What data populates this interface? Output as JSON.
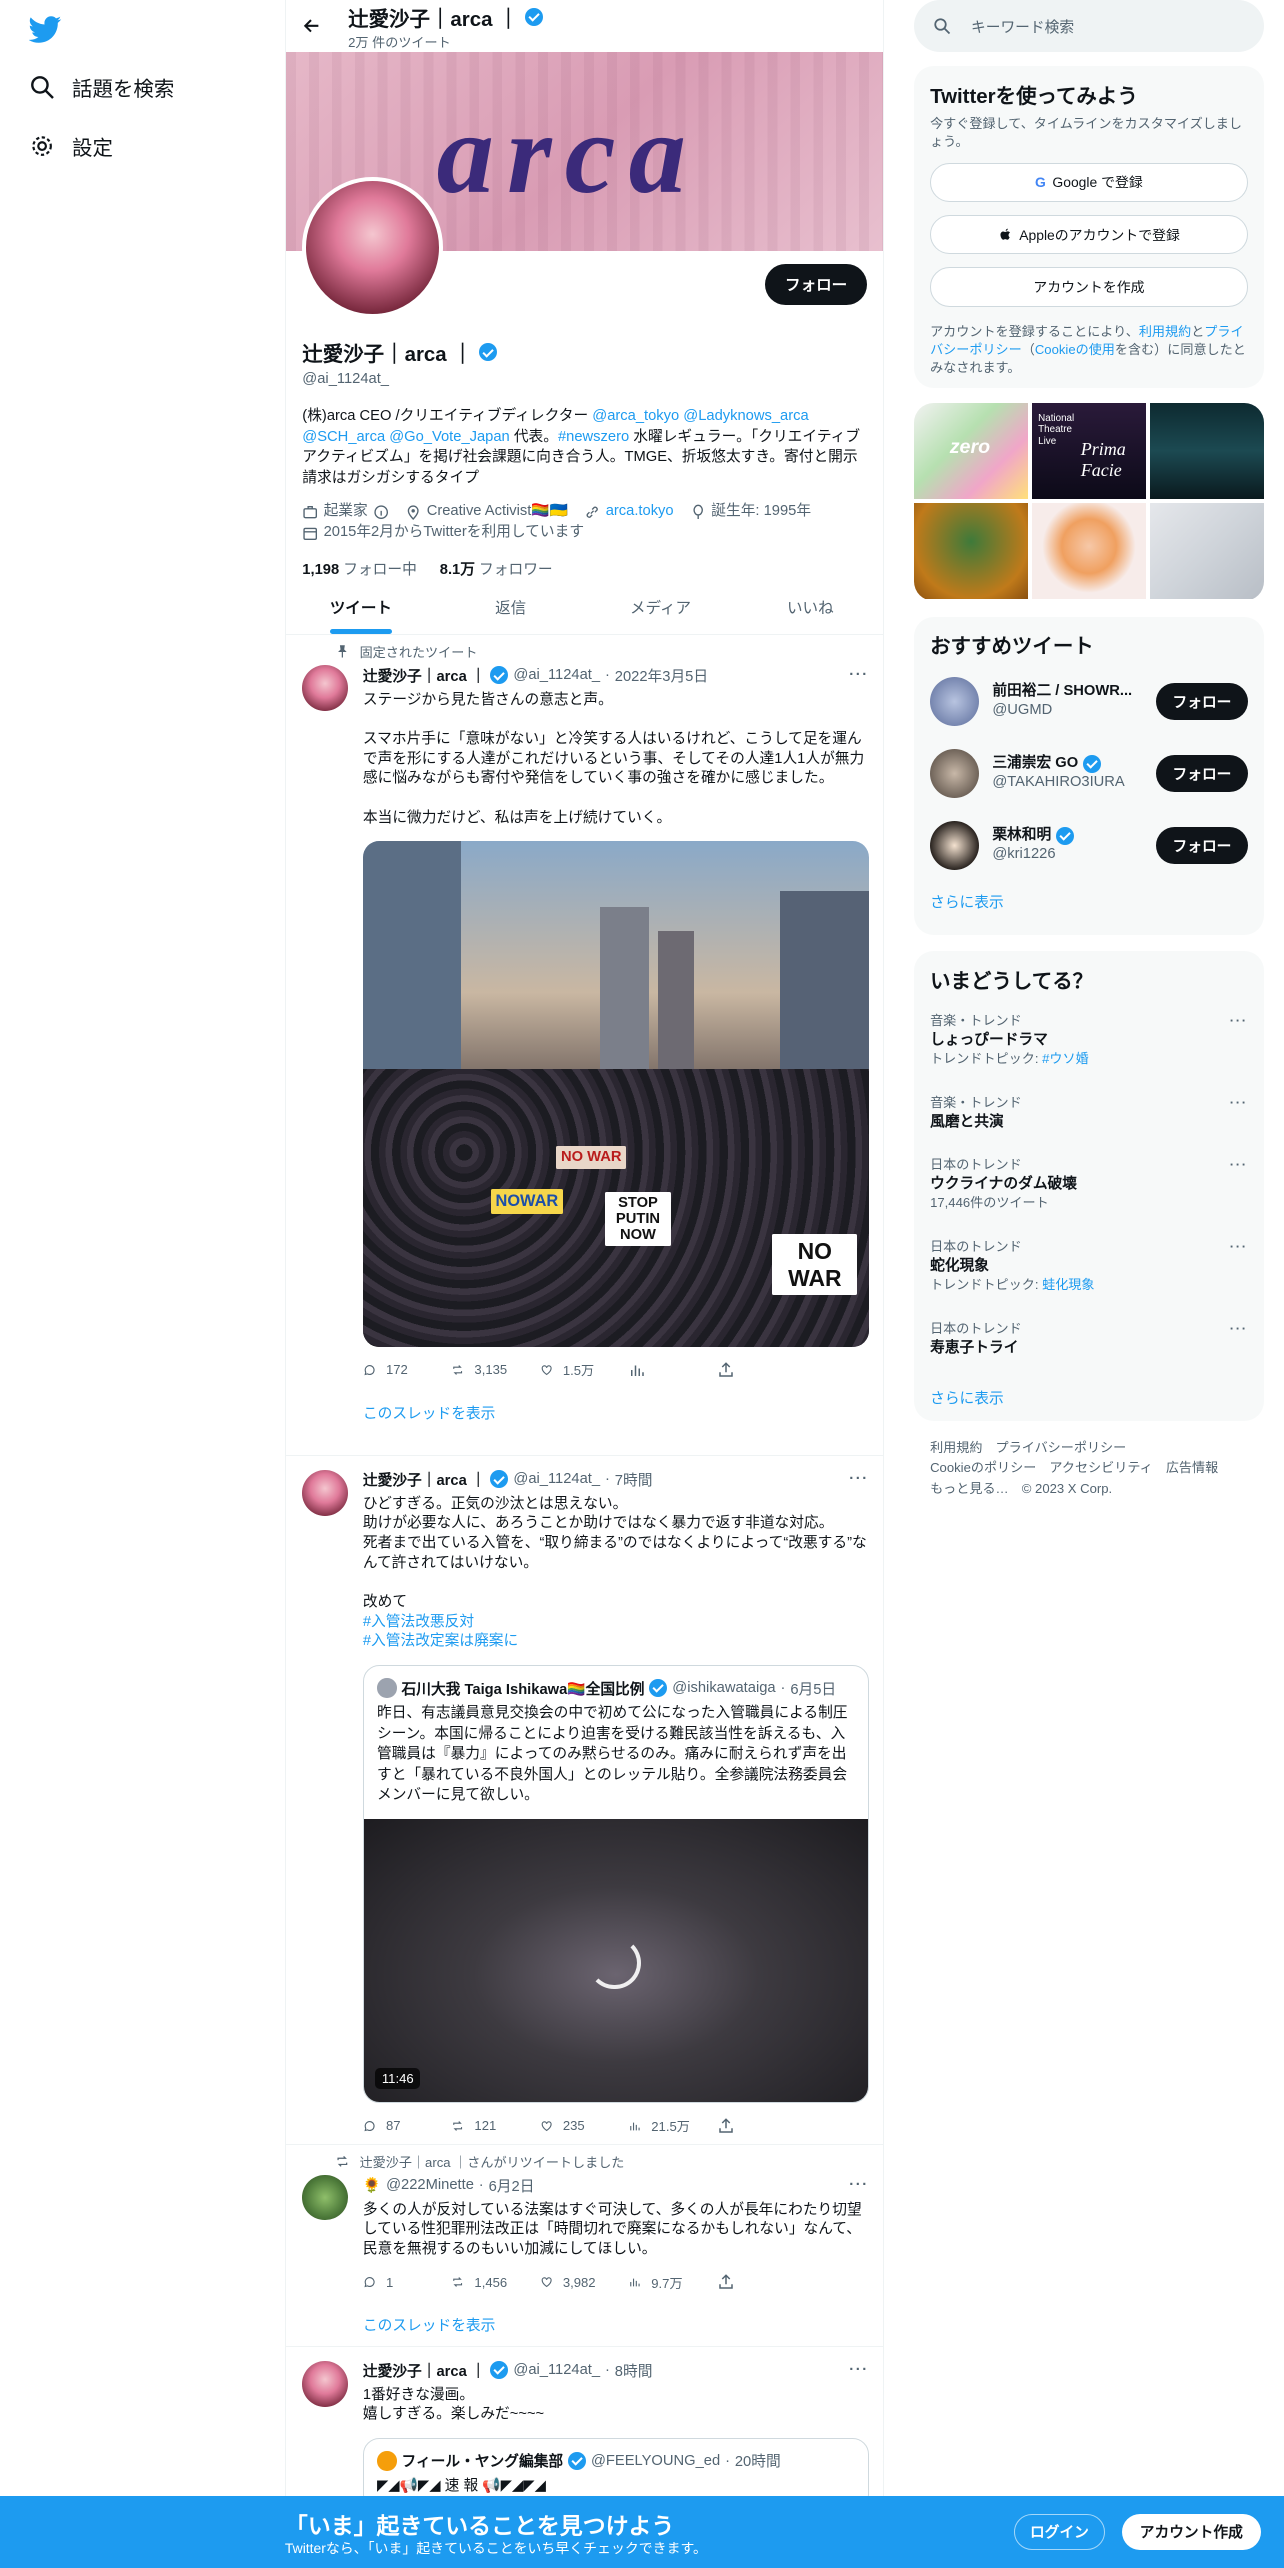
{
  "nav": {
    "logo_icon": "twitter-bird-icon",
    "explore_label": "話題を検索",
    "settings_label": "設定"
  },
  "header": {
    "back_icon": "arrow-left-icon",
    "name": "辻愛沙子｜arca ｜",
    "tweet_count": "2万 件のツイート"
  },
  "banner": {
    "word": "arca"
  },
  "profile": {
    "follow_label": "フォロー",
    "name": "辻愛沙子｜arca ｜",
    "handle": "@ai_1124at_",
    "bio_1": "(株)arca CEO /クリエイティブディレクター ",
    "bio_link_1": "@arca_tokyo @Ladyknows_arca @SCH_arca @Go_Vote_Japan",
    "bio_2": " 代表。",
    "bio_link_2": "#newszero",
    "bio_3": " 水曜レギュラー。「クリエイティブアクティビズム」を掲げ社会課題に向き合う人。TMGE、折坂悠太すき。寄付と開示請求はガシガシするタイプ",
    "category": "起業家",
    "location": "Creative Activist🏳️‍🌈🇺🇦",
    "website": "arca.tokyo",
    "birthday": "誕生年: 1995年",
    "joined": "2015年2月からTwitterを利用しています",
    "following_count": "1,198",
    "following_label": "フォロー中",
    "followers_count": "8.1万",
    "followers_label": "フォロワー"
  },
  "tabs": [
    "ツイート",
    "返信",
    "メディア",
    "いいね"
  ],
  "tweets": [
    {
      "pinned_label": "固定されたツイート",
      "name": "辻愛沙子｜arca ｜",
      "handle": "@ai_1124at_",
      "time": "2022年3月5日",
      "text": "ステージから見た皆さんの意志と声。\n\nスマホ片手に「意味がない」と冷笑する人はいるけれど、こうして足を運んで声を形にする人達がこれだけいるという事、そしてその人達1人1人が無力感に悩みながらも寄付や発信をしていく事の強さを確かに感じました。\n\n本当に微力だけど、私は声を上げ続けていく。",
      "signs": [
        "NOWAR",
        "STOP PUTIN NOW",
        "NO WAR",
        "NO WAR"
      ],
      "replies": "172",
      "retweets": "3,135",
      "likes": "1.5万",
      "show_thread": "このスレッドを表示"
    },
    {
      "name": "辻愛沙子｜arca ｜",
      "handle": "@ai_1124at_",
      "time": "7時間",
      "text": "ひどすぎる。正気の沙汰とは思えない。\n助けが必要な人に、あろうことか助けではなく暴力で返す非道な対応。\n死者まで出ている入管を、“取り締まる”のではなくよりによって“改悪する”なんて許されてはいけない。\n\n改めて",
      "hashtag_1": "#入管法改悪反対",
      "hashtag_2": "#入管法改定案は廃案に",
      "quote_name": "石川大我 Taiga Ishikawa🏳️‍🌈全国比例",
      "quote_handle": "@ishikawataiga",
      "quote_time": "6月5日",
      "quote_text": "昨日、有志議員意見交換会の中で初めて公になった入管職員による制圧シーン。本国に帰ることにより迫害を受ける難民該当性を訴えるも、入管職員は『暴力』によってのみ黙らせるのみ。痛みに耐えられず声を出すと「暴れている不良外国人」とのレッテル貼り。全参議院法務委員会メンバーに見て欲しい。",
      "video_duration": "11:46",
      "replies": "87",
      "retweets": "121",
      "likes": "235",
      "views": "21.5万"
    },
    {
      "retweet_label": "辻愛沙子｜arca ｜さんがリツイートしました",
      "name": "🌻",
      "handle": "@222Minette",
      "time": "6月2日",
      "text": "多くの人が反対している法案はすぐ可決して、多くの人が長年にわたり切望している性犯罪刑法改正は「時間切れで廃案になるかもしれない」なんて、民意を無視するのもいい加減にしてほしい。",
      "replies": "1",
      "retweets": "1,456",
      "likes": "3,982",
      "views": "9.7万",
      "show_thread": "このスレッドを表示"
    },
    {
      "name": "辻愛沙子｜arca ｜",
      "handle": "@ai_1124at_",
      "time": "8時間",
      "text": "1番好きな漫画。\n嬉しすぎる。楽しみだ~~~~",
      "quote_name": "フィール・ヤング編集部",
      "quote_handle": "@FEELYOUNG_ed",
      "quote_time": "20時間",
      "quote_text": "◤◢📢◤◢ 速 報 📢◤◢◤◢"
    }
  ],
  "right": {
    "search_placeholder": "キーワード検索",
    "signup_card": {
      "title": "Twitterを使ってみよう",
      "subtitle": "今すぐ登録して、タイムラインをカスタマイズしましょう。",
      "google": "Google で登録",
      "apple": "Appleのアカウントで登録",
      "create": "アカウントを作成",
      "terms_1": "アカウントを登録することにより、",
      "terms_link_1": "利用規約",
      "terms_2": "と",
      "terms_link_2": "プライバシーポリシー",
      "terms_3": "（",
      "terms_link_3": "Cookieの使用",
      "terms_4": "を含む）に同意したとみなされます。"
    },
    "media_grid_texts": [
      "zero",
      "National Theatre Live",
      "Prima Facie"
    ],
    "recommend": {
      "title": "おすすめツイート",
      "items": [
        {
          "name": "前田裕二 / SHOWR...",
          "handle": "@UGMD",
          "follow": "フォロー"
        },
        {
          "name": "三浦崇宏 GO",
          "handle": "@TAKAHIRO3IURA",
          "follow": "フォロー"
        },
        {
          "name": "栗林和明",
          "handle": "@kri1226",
          "follow": "フォロー"
        }
      ],
      "more": "さらに表示"
    },
    "trends": {
      "title": "いまどうしてる？",
      "items": [
        {
          "context": "音楽・トレンド",
          "name": "しょっぴードラマ",
          "extra_label": "トレンドトピック: ",
          "extra_link": "#ウソ婚"
        },
        {
          "context": "音楽・トレンド",
          "name": "風磨と共演"
        },
        {
          "context": "日本のトレンド",
          "name": "ウクライナのダム破壊",
          "extra_text": "17,446件のツイート"
        },
        {
          "context": "日本のトレンド",
          "name": "蛇化現象",
          "extra_label": "トレンドトピック: ",
          "extra_link": "蛙化現象"
        },
        {
          "context": "日本のトレンド",
          "name": "寿恵子トライ"
        }
      ],
      "more": "さらに表示"
    },
    "footer": {
      "line1": "利用規約　プライバシーポリシー",
      "line2": "Cookieのポリシー　アクセシビリティ　広告情報",
      "line3": "もっと見る…　© 2023 X Corp."
    }
  },
  "bottombar": {
    "headline": "「いま」起きていることを見つけよう",
    "sub": "Twitterなら、「いま」起きていることをいち早くチェックできます。",
    "login": "ログイン",
    "signup": "アカウント作成"
  },
  "colors": {
    "accent": "#1d9bf0",
    "text": "#0f1419",
    "muted": "#536471",
    "bottombar": "#1d9bf0"
  }
}
